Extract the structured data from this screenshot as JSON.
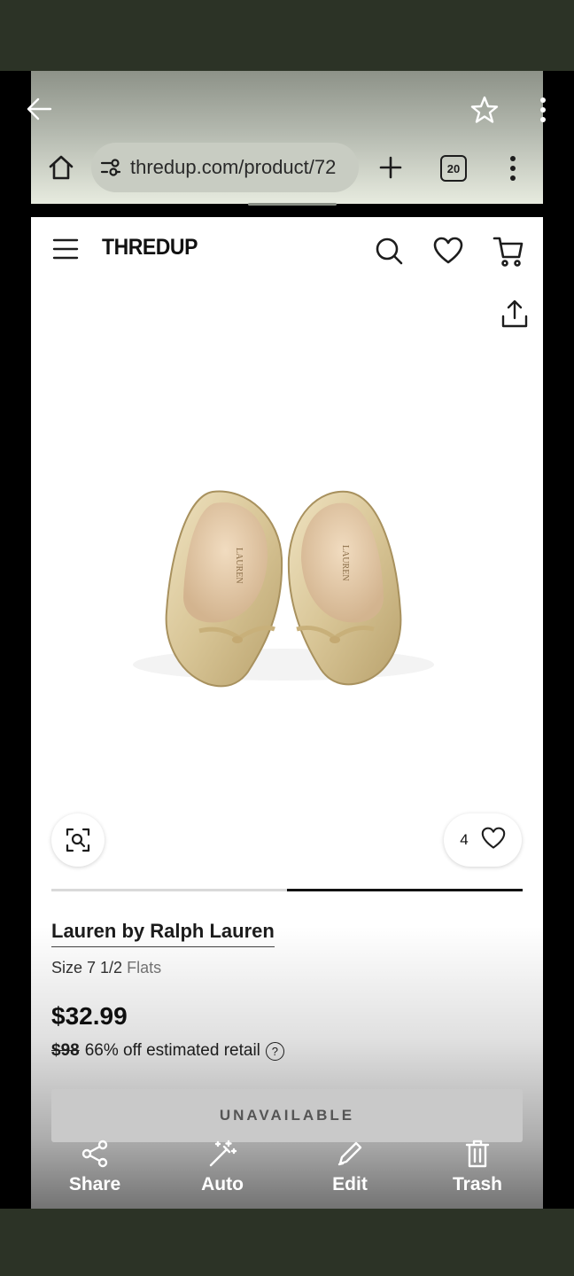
{
  "browser": {
    "url": "thredup.com/product/72",
    "tab_count": "20"
  },
  "site": {
    "logo": "THREDUP"
  },
  "product": {
    "favorite_count": "4",
    "brand": "Lauren by Ralph Lauren",
    "size_label": "Size 7 1/2",
    "category": "Flats",
    "price": "$32.99",
    "original_price": "$98",
    "discount_text": "66% off estimated retail",
    "help_symbol": "?",
    "status_button": "UNAVAILABLE",
    "image_progress": 0.5
  },
  "insole_text": "LAUREN",
  "actions": [
    {
      "label": "Share",
      "icon": "share-icon"
    },
    {
      "label": "Auto",
      "icon": "magic-wand-icon"
    },
    {
      "label": "Edit",
      "icon": "pencil-icon"
    },
    {
      "label": "Trash",
      "icon": "trash-icon"
    }
  ]
}
